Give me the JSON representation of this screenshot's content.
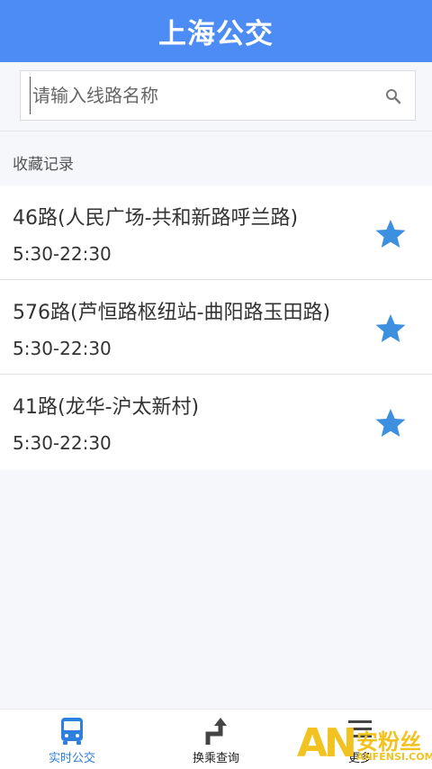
{
  "header": {
    "title": "上海公交"
  },
  "search": {
    "placeholder": "请输入线路名称"
  },
  "favorites": {
    "section_title": "收藏记录",
    "items": [
      {
        "name": "46路(人民广场-共和新路呼兰路)",
        "time": "5:30-22:30"
      },
      {
        "name": "576路(芦恒路枢纽站-曲阳路玉田路)",
        "time": "5:30-22:30"
      },
      {
        "name": "41路(龙华-沪太新村)",
        "time": "5:30-22:30"
      }
    ]
  },
  "bottom_nav": {
    "items": [
      {
        "label": "实时公交",
        "icon": "bus-icon",
        "active": true
      },
      {
        "label": "换乘查询",
        "icon": "transfer-icon",
        "active": false
      },
      {
        "label": "更多",
        "icon": "menu-icon",
        "active": false
      }
    ]
  },
  "watermark": {
    "logo": "AN",
    "cn": "安粉丝",
    "en": "ANFENSI.COM"
  },
  "colors": {
    "primary": "#4d8cf5",
    "star": "#3d8fe0",
    "active_nav": "#2f7fe0"
  }
}
